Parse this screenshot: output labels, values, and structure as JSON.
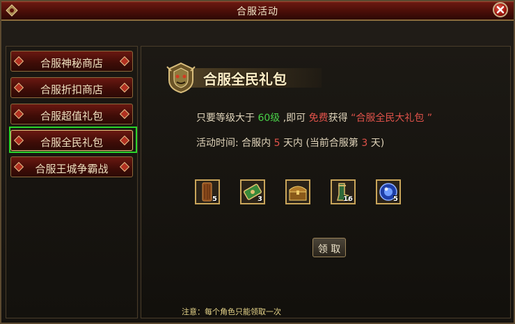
{
  "window": {
    "title": "合服活动"
  },
  "sidebar": {
    "items": [
      {
        "label": "合服神秘商店"
      },
      {
        "label": "合服折扣商店"
      },
      {
        "label": "合服超值礼包"
      },
      {
        "label": "合服全民礼包"
      },
      {
        "label": "合服王城争霸战"
      }
    ],
    "selected_index": 3
  },
  "panel": {
    "heading": "合服全民礼包",
    "line1": {
      "a": "只要等级大于 ",
      "level": "60级",
      "b": " ,即可 ",
      "free": "免费",
      "c": "获得 ",
      "gift": "“合服全民大礼包 ”"
    },
    "line2": {
      "a": "活动时间: 合服内 ",
      "days": "5",
      "b": " 天内 (当前合服第 ",
      "current": "3",
      "c": " 天)"
    },
    "rewards": [
      {
        "icon": "wood-plank-icon",
        "count": "5"
      },
      {
        "icon": "scroll-icon",
        "count": "3"
      },
      {
        "icon": "treasure-chest-icon",
        "count": ""
      },
      {
        "icon": "boots-icon",
        "count": "16"
      },
      {
        "icon": "blue-orb-icon",
        "count": "5"
      }
    ],
    "claim_label": "领 取",
    "note": "注意：每个角色只能领取一次"
  },
  "colors": {
    "highlight_green": "#48d048",
    "highlight_red": "#e0524a",
    "selection_border": "#2bd52b"
  }
}
